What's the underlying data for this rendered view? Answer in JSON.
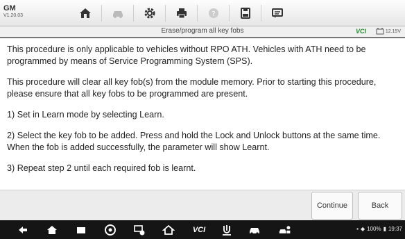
{
  "header": {
    "make": "GM",
    "version": "V1.20.03"
  },
  "toolbar": {
    "tools": [
      {
        "icon": "home-icon"
      },
      {
        "icon": "vehicle-swap-icon",
        "disabled": true
      },
      {
        "icon": "settings-gear-icon"
      },
      {
        "icon": "printer-icon"
      },
      {
        "icon": "help-icon",
        "disabled": true
      },
      {
        "icon": "save-icon"
      },
      {
        "icon": "message-icon"
      }
    ]
  },
  "status": {
    "title": "Erase/program all key fobs",
    "vci": "VCI",
    "voltage": "12.15V"
  },
  "content": {
    "paragraphs": [
      "This procedure is only applicable to vehicles without RPO ATH. Vehicles with ATH need to be programmed by means of Service Programming System (SPS).",
      "This procedure will clear all key fob(s) from the module memory. Prior to starting this procedure, please ensure that all key fobs to be programmed are present.",
      "1) Set in Learn mode by selecting Learn.",
      "2) Select the key fob to be added. Press and hold the Lock and Unlock buttons at the same time. When the fob is added successfully, the parameter will show Learnt.",
      "3) Repeat step 2 until each required fob is learnt."
    ]
  },
  "buttons": {
    "continue_label": "Continue",
    "back_label": "Back"
  },
  "navbar": {
    "vci_label": "VCI",
    "battery": "100%",
    "time": "19:37"
  },
  "colors": {
    "vci_green": "#1e8a2a",
    "navbar_bg": "#151515"
  }
}
